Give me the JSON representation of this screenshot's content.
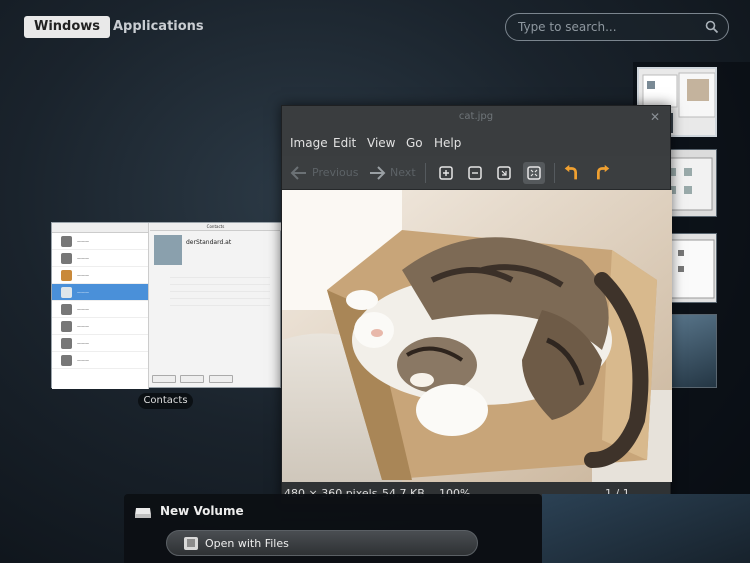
{
  "top_bar": {
    "tab_windows": "Windows",
    "tab_applications": "Applications",
    "search_placeholder": "Type to search...",
    "search_icon": "search-icon"
  },
  "contacts_window": {
    "title": "Contacts",
    "contact_name": "derStandard.at",
    "caption": "Contacts"
  },
  "viewer": {
    "title": "cat.jpg",
    "menu": [
      "Image",
      "Edit",
      "View",
      "Go",
      "Help"
    ],
    "toolbar": {
      "previous": "Previous",
      "next": "Next"
    },
    "status": {
      "dimensions": "480 × 360 pixels",
      "size": "54.7 KB",
      "zoom": "100%",
      "page": "1 / 1"
    }
  },
  "volume_popup": {
    "title": "New Volume",
    "open_label": "Open with Files"
  },
  "colors": {
    "accent_orange": "#f0a030",
    "selection_blue": "#4a90d9"
  }
}
